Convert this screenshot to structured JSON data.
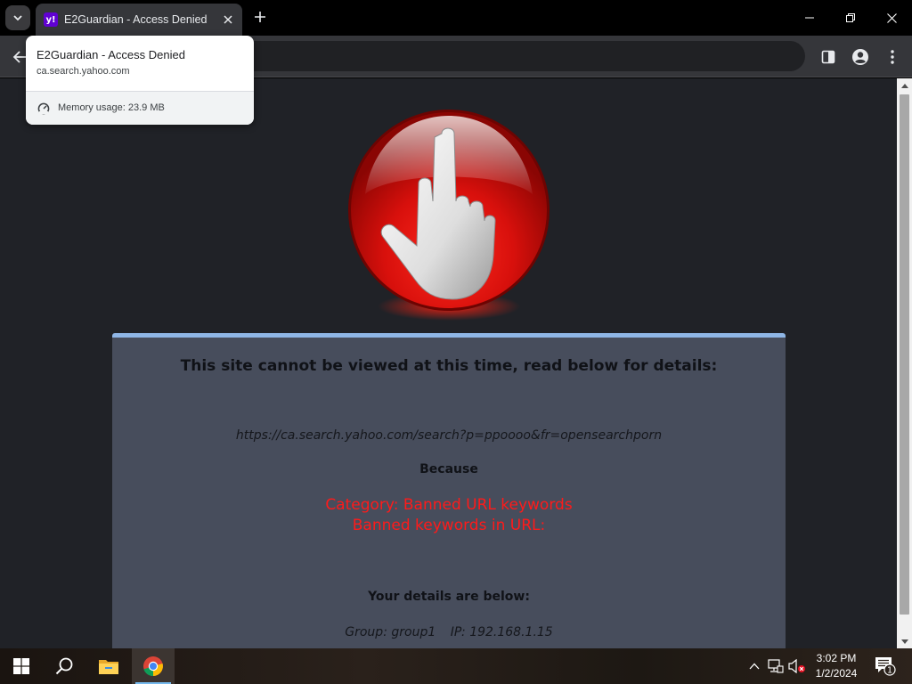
{
  "browser": {
    "tab": {
      "title": "E2Guardian - Access Denied",
      "favicon_letter": "y!",
      "favicon_color": "#6001d2"
    },
    "hovercard": {
      "title": "E2Guardian - Access Denied",
      "domain": "ca.search.yahoo.com",
      "memory": "Memory usage: 23.9 MB"
    },
    "icons": [
      "tab-search-icon",
      "close-icon",
      "plus-icon",
      "minimize-icon",
      "restore-icon",
      "close-window-icon",
      "back-arrow-icon",
      "side-panel-icon",
      "profile-icon",
      "more-menu-icon",
      "gauge-icon"
    ]
  },
  "page": {
    "heading": "This site cannot be viewed at this time, read below for details:",
    "blocked_url": "https://ca.search.yahoo.com/search?p=ppoooo&fr=opensearchporn",
    "because": "Because",
    "category": "Category: Banned URL keywords",
    "keywords": "Banned keywords in URL:",
    "details_heading": "Your details are below:",
    "group": "Group: group1",
    "ip": "IP: 192.168.1.15",
    "colors": {
      "background": "#202227",
      "panel": "#474d5c",
      "panel_border": "#8fb6e6",
      "alert": "#ff1a1a"
    }
  },
  "taskbar": {
    "time": "3:02 PM",
    "date": "1/2/2024",
    "notification_count": "1",
    "icons": [
      "windows-start-icon",
      "search-icon",
      "file-explorer-icon",
      "chrome-icon",
      "chevron-up-icon",
      "network-icon",
      "volume-muted-icon",
      "notification-icon"
    ]
  }
}
